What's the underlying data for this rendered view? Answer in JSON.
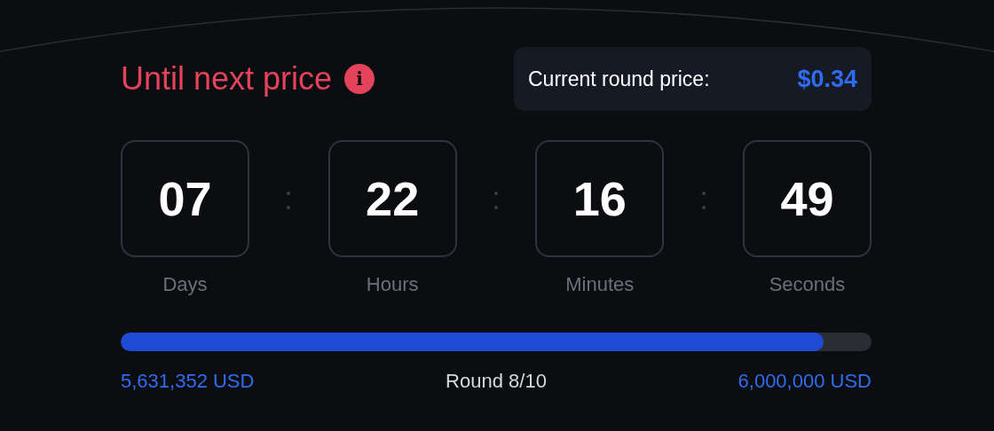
{
  "header": {
    "title": "Until next price",
    "info_icon": "i"
  },
  "price_card": {
    "label": "Current round price:",
    "value": "$0.34"
  },
  "countdown": [
    {
      "value": "07",
      "label": "Days"
    },
    {
      "value": "22",
      "label": "Hours"
    },
    {
      "value": "16",
      "label": "Minutes"
    },
    {
      "value": "49",
      "label": "Seconds"
    }
  ],
  "progress": {
    "level": 0.936,
    "raised": "5,631,352 USD",
    "round": "Round 8/10",
    "goal": "6,000,000 USD"
  }
}
